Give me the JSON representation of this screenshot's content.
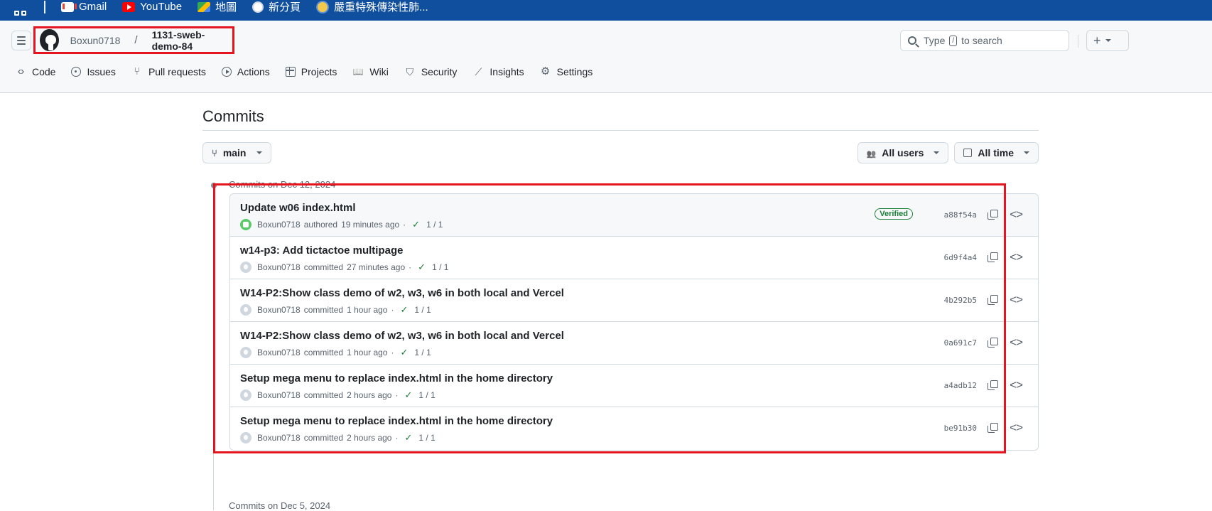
{
  "bookmarks": [
    {
      "label": "Gmail",
      "icon": "gmail-icon"
    },
    {
      "label": "YouTube",
      "icon": "youtube-icon"
    },
    {
      "label": "地圖",
      "icon": "maps-icon"
    },
    {
      "label": "新分頁",
      "icon": "globe-icon"
    },
    {
      "label": "嚴重特殊傳染性肺...",
      "icon": "gov-icon"
    }
  ],
  "header": {
    "owner": "Boxun0718",
    "separator": "/",
    "repo": "1131-sweb-demo-84",
    "search_prefix": "Type",
    "search_key": "/",
    "search_suffix": "to search",
    "plus_label": "+"
  },
  "repo_nav": [
    {
      "label": "Code",
      "icon": "code-icon"
    },
    {
      "label": "Issues",
      "icon": "issue-opened-icon"
    },
    {
      "label": "Pull requests",
      "icon": "git-pull-request-icon"
    },
    {
      "label": "Actions",
      "icon": "play-icon"
    },
    {
      "label": "Projects",
      "icon": "table-icon"
    },
    {
      "label": "Wiki",
      "icon": "book-icon"
    },
    {
      "label": "Security",
      "icon": "shield-icon"
    },
    {
      "label": "Insights",
      "icon": "graph-icon"
    },
    {
      "label": "Settings",
      "icon": "gear-icon"
    }
  ],
  "page": {
    "title": "Commits",
    "branch": "main",
    "users_filter": "All users",
    "time_filter": "All time",
    "group_header": "Commits on Dec 12, 2024",
    "next_group_header": "Commits on Dec 5, 2024"
  },
  "commits": [
    {
      "title": "Update w06 index.html",
      "author": "Boxun0718",
      "action": "authored",
      "time": "19 minutes ago",
      "checks": "1 / 1",
      "verified": "Verified",
      "sha": "a88f54a"
    },
    {
      "title": "w14-p3: Add tictactoe multipage",
      "author": "Boxun0718",
      "action": "committed",
      "time": "27 minutes ago",
      "checks": "1 / 1",
      "sha": "6d9f4a4"
    },
    {
      "title": "W14-P2:Show class demo of w2, w3, w6 in both local and Vercel",
      "author": "Boxun0718",
      "action": "committed",
      "time": "1 hour ago",
      "checks": "1 / 1",
      "sha": "4b292b5"
    },
    {
      "title": "W14-P2:Show class demo of w2, w3, w6 in both local and Vercel",
      "author": "Boxun0718",
      "action": "committed",
      "time": "1 hour ago",
      "checks": "1 / 1",
      "sha": "0a691c7"
    },
    {
      "title": "Setup mega menu to replace index.html in the home directory",
      "author": "Boxun0718",
      "action": "committed",
      "time": "2 hours ago",
      "checks": "1 / 1",
      "sha": "a4adb12"
    },
    {
      "title": "Setup mega menu to replace index.html in the home directory",
      "author": "Boxun0718",
      "action": "committed",
      "time": "2 hours ago",
      "checks": "1 / 1",
      "sha": "be91b30"
    }
  ],
  "colors": {
    "bookmark_bar": "#0f4f9e",
    "highlight": "#e5141f",
    "success": "#1a7f37"
  }
}
